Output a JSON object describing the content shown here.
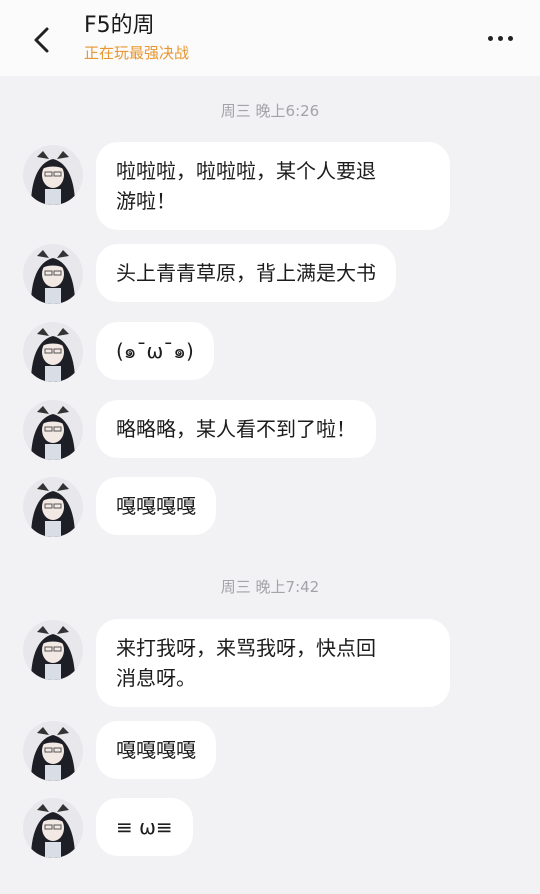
{
  "header": {
    "title": "F5的周",
    "status": "正在玩最强决战"
  },
  "timestamps": [
    "周三 晚上6:26",
    "周三 晚上7:42"
  ],
  "messages": [
    "啦啦啦，啦啦啦，某个人要退\n游啦！",
    "头上青青草原，背上满是大书",
    "(๑¯ω¯๑)",
    "略略略，某人看不到了啦！",
    "嘎嘎嘎嘎",
    "来打我呀，来骂我呀，快点回\n消息呀。",
    "嘎嘎嘎嘎",
    "≡ ω≡"
  ]
}
